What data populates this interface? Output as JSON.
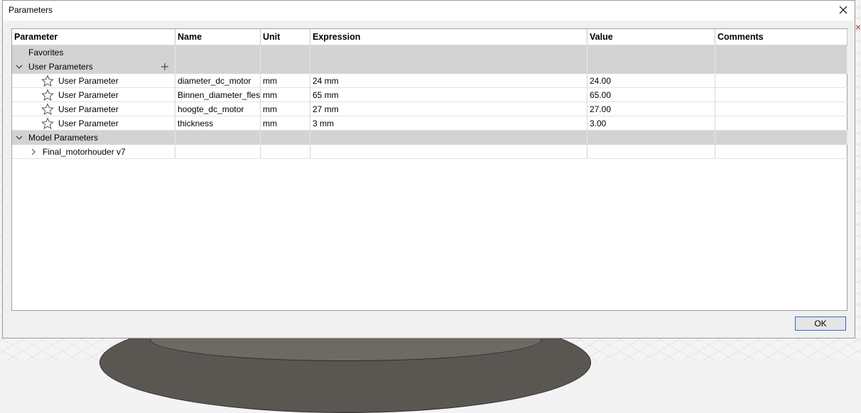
{
  "window": {
    "title": "Parameters"
  },
  "table": {
    "headers": [
      "Parameter",
      "Name",
      "Unit",
      "Expression",
      "Value",
      "Comments"
    ],
    "favorites_label": "Favorites",
    "user_parameters_label": "User Parameters",
    "model_parameters_label": "Model Parameters",
    "user_rows": [
      {
        "parameter": "User Parameter",
        "name": "diameter_dc_motor",
        "unit": "mm",
        "expression": "24 mm",
        "value": "24.00",
        "comments": ""
      },
      {
        "parameter": "User Parameter",
        "name": "Binnen_diameter_fles",
        "unit": "mm",
        "expression": "65 mm",
        "value": "65.00",
        "comments": ""
      },
      {
        "parameter": "User Parameter",
        "name": "hoogte_dc_motor",
        "unit": "mm",
        "expression": "27 mm",
        "value": "27.00",
        "comments": ""
      },
      {
        "parameter": "User Parameter",
        "name": "thickness",
        "unit": "mm",
        "expression": "3 mm",
        "value": "3.00",
        "comments": ""
      }
    ],
    "model_children": [
      {
        "label": "Final_motorhouder v7"
      }
    ]
  },
  "buttons": {
    "ok_label": "OK"
  },
  "icons": {
    "close": "close-icon",
    "expand": "chevron-down-icon",
    "collapse": "chevron-right-icon",
    "star": "star-icon",
    "add": "plus-icon"
  },
  "colors": {
    "group_row_bg": "#d3d3d3",
    "ok_border": "#2b6fc2"
  }
}
